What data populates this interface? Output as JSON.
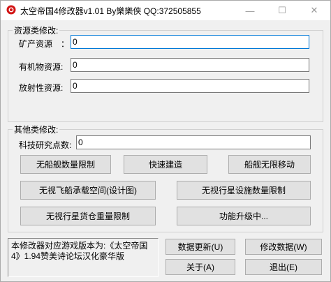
{
  "window": {
    "title": "太空帝国4修改器v1.01 By樂樂侠 QQ:372505855",
    "minimize_glyph": "—",
    "maximize_glyph": "☐",
    "close_glyph": "✕"
  },
  "resources": {
    "legend": "资源类修改:",
    "rows": [
      {
        "label": "矿产资源　：",
        "value": "0"
      },
      {
        "label": "有机物资源:",
        "value": "0"
      },
      {
        "label": "放射性资源:",
        "value": "0"
      }
    ]
  },
  "other": {
    "legend": "其他类修改:",
    "research_label": "科技研究点数:",
    "research_value": "0",
    "buttons": {
      "no_ship_limit": "无船舰数量限制",
      "fast_build": "快速建造",
      "unlimited_move": "船舰无限移动",
      "ignore_carrier_space": "无视飞船承载空间(设计图)",
      "ignore_planet_facility": "无视行星设施数量限制",
      "ignore_cargo_weight": "无视行星货仓重量限制",
      "upgrading": "功能升级中..."
    }
  },
  "footer": {
    "info_text": "本修改器对应游戏版本为:《太空帝国4》1.94赞美诗论坛汉化豪华版",
    "update_button": "数据更新(U)",
    "modify_button": "修改数据(W)",
    "about_button": "关于(A)",
    "exit_button": "退出(E)"
  },
  "colors": {
    "focus_border": "#0078d7",
    "icon_red": "#d21414"
  }
}
